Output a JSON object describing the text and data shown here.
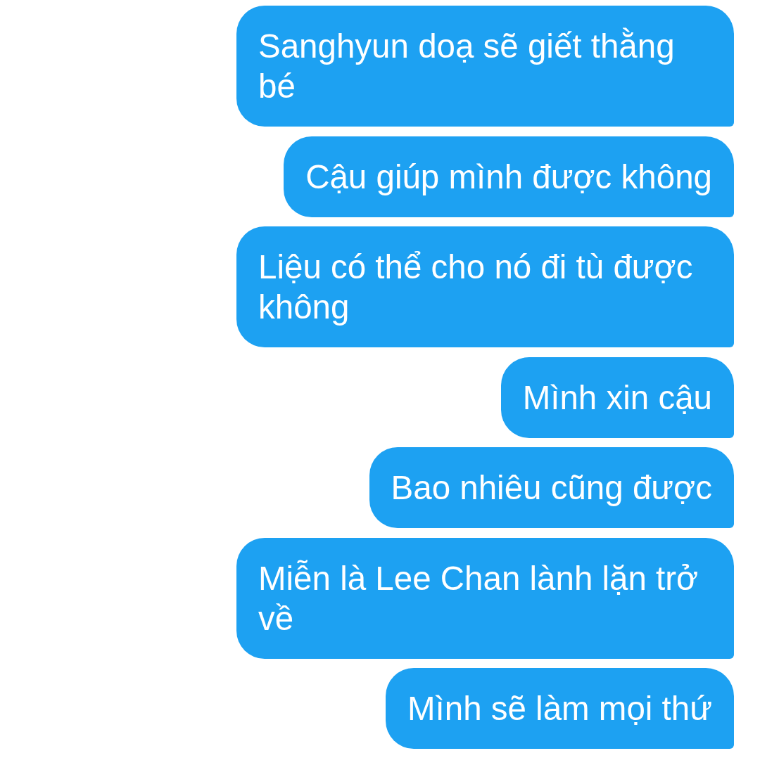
{
  "messages": [
    {
      "text": "Sanghyun doạ sẽ giết thằng bé"
    },
    {
      "text": "Cậu giúp mình được không"
    },
    {
      "text": "Liệu có thể cho nó đi tù được không"
    },
    {
      "text": "Mình xin cậu"
    },
    {
      "text": "Bao nhiêu cũng được"
    },
    {
      "text": "Miễn là Lee Chan lành lặn trở về"
    },
    {
      "text": "Mình sẽ làm mọi thứ"
    }
  ]
}
